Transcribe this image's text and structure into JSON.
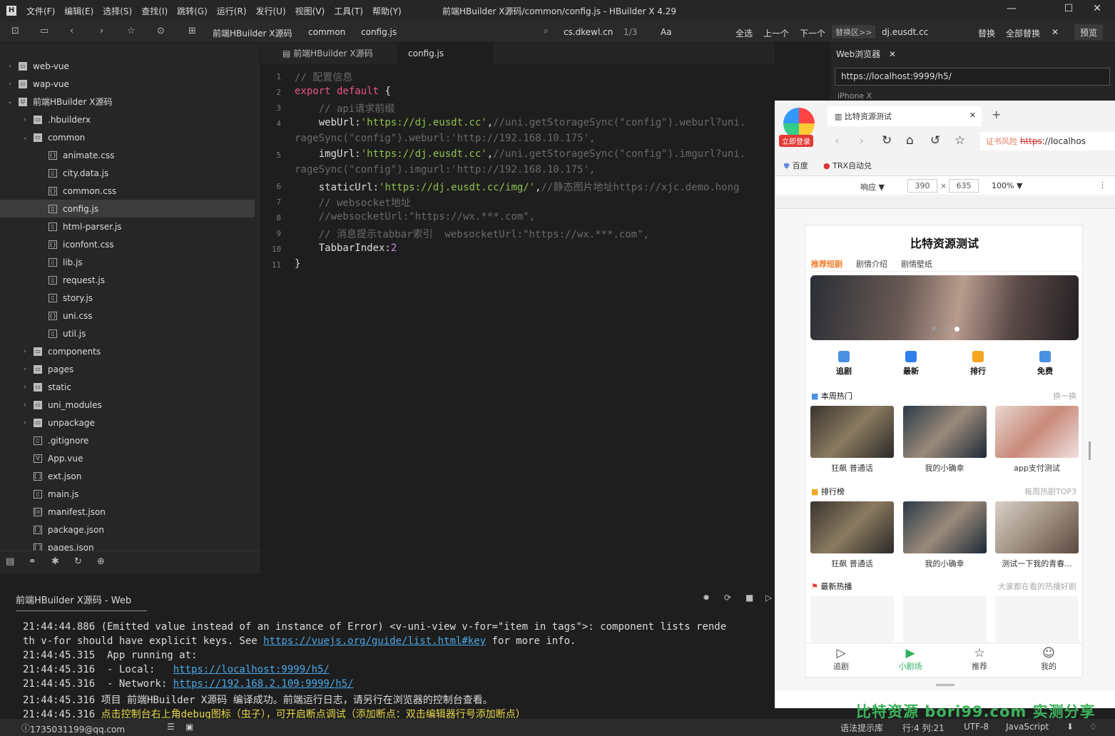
{
  "window": {
    "title": "前端HBuilder X源码/common/config.js - HBuilder X 4.29",
    "menu": [
      "文件(F)",
      "编辑(E)",
      "选择(S)",
      "查找(I)",
      "跳转(G)",
      "运行(R)",
      "发行(U)",
      "视图(V)",
      "工具(T)",
      "帮助(Y)"
    ]
  },
  "toolbar": {
    "crumbs": [
      "前端HBuilder X源码",
      "common",
      "config.js"
    ],
    "find_value": "cs.dkewl.cn",
    "find_count": "1/3",
    "aa": "Aa",
    "select_all": "全选",
    "prev": "上一个",
    "next": "下一个",
    "replace_area": "替换区>>",
    "replace_value": "dj.eusdt.cc",
    "replace": "替换",
    "replace_all": "全部替换",
    "preview": "预览"
  },
  "tree": [
    {
      "label": "web-vue",
      "depth": 0,
      "twisty": "›",
      "icon": "folder"
    },
    {
      "label": "wap-vue",
      "depth": 0,
      "twisty": "›",
      "icon": "folder"
    },
    {
      "label": "前端HBuilder X源码",
      "depth": 0,
      "twisty": "⌄",
      "icon": "project"
    },
    {
      "label": ".hbuilderx",
      "depth": 1,
      "twisty": "›",
      "icon": "folder"
    },
    {
      "label": "common",
      "depth": 1,
      "twisty": "⌄",
      "icon": "folder"
    },
    {
      "label": "animate.css",
      "depth": 2,
      "icon": "{}"
    },
    {
      "label": "city.data.js",
      "depth": 2,
      "icon": "file"
    },
    {
      "label": "common.css",
      "depth": 2,
      "icon": "{}"
    },
    {
      "label": "config.js",
      "depth": 2,
      "icon": "file",
      "selected": true
    },
    {
      "label": "html-parser.js",
      "depth": 2,
      "icon": "file"
    },
    {
      "label": "iconfont.css",
      "depth": 2,
      "icon": "{}"
    },
    {
      "label": "lib.js",
      "depth": 2,
      "icon": "file"
    },
    {
      "label": "request.js",
      "depth": 2,
      "icon": "file"
    },
    {
      "label": "story.js",
      "depth": 2,
      "icon": "file"
    },
    {
      "label": "uni.css",
      "depth": 2,
      "icon": "{}"
    },
    {
      "label": "util.js",
      "depth": 2,
      "icon": "file"
    },
    {
      "label": "components",
      "depth": 1,
      "twisty": "›",
      "icon": "folder"
    },
    {
      "label": "pages",
      "depth": 1,
      "twisty": "›",
      "icon": "folder"
    },
    {
      "label": "static",
      "depth": 1,
      "twisty": "›",
      "icon": "folder"
    },
    {
      "label": "uni_modules",
      "depth": 1,
      "twisty": "›",
      "icon": "folder"
    },
    {
      "label": "unpackage",
      "depth": 1,
      "twisty": "›",
      "icon": "folder"
    },
    {
      "label": ".gitignore",
      "depth": 1,
      "icon": "file"
    },
    {
      "label": "App.vue",
      "depth": 1,
      "icon": "V"
    },
    {
      "label": "ext.json",
      "depth": 1,
      "icon": "[]"
    },
    {
      "label": "main.js",
      "depth": 1,
      "icon": "file"
    },
    {
      "label": "manifest.json",
      "depth": 1,
      "icon": "[o]"
    },
    {
      "label": "package.json",
      "depth": 1,
      "icon": "[]"
    },
    {
      "label": "pages.json",
      "depth": 1,
      "icon": "[]"
    }
  ],
  "tabs": [
    "前端HBuilder X源码",
    "config.js"
  ],
  "code": [
    {
      "n": "1",
      "html": "<span class=cm>// 配置信息</span>"
    },
    {
      "n": "2",
      "html": "<span class=kw>export default</span> {"
    },
    {
      "n": "3",
      "html": "    <span class=cm>// api请求前缀</span>"
    },
    {
      "n": "4",
      "html": "    webUrl:<span class=st>'https://dj.eusdt.cc'</span>,<span class=cm>//uni.getStorageSync(\"config\").weburl?uni.</span>"
    },
    {
      "n": "",
      "html": "<span class=cm>rageSync(\"config\").weburl:'http://192.168.10.175',</span>"
    },
    {
      "n": "5",
      "html": "    imgUrl:<span class=st>'https://dj.eusdt.cc'</span>,<span class=cm>//uni.getStorageSync(\"config\").imgurl?uni.</span>"
    },
    {
      "n": "",
      "html": "<span class=cm>rageSync(\"config\").imgurl:'http://192.168.10.175',</span>"
    },
    {
      "n": "6",
      "html": "    staticUrl:<span class=st>'https://dj.eusdt.cc/img/'</span>,<span class=cm>//静态图片地址https://xjc.demo.hong</span>"
    },
    {
      "n": "7",
      "html": "    <span class=cm>// websocket地址</span>"
    },
    {
      "n": "8",
      "html": "    <span class=cm>//websocketUrl:\"https://wx.***.com\",</span>"
    },
    {
      "n": "9",
      "html": "    <span class=cm>// 消息提示tabbar索引  websocketUrl:\"https://wx.***.com\",</span>"
    },
    {
      "n": "10",
      "html": "    TabbarIndex:<span class=nm>2</span>"
    },
    {
      "n": "11",
      "html": "}"
    }
  ],
  "webview": {
    "tab": "Web浏览器",
    "url": "https://localhost:9999/h5/",
    "device": "iPhone X"
  },
  "browser": {
    "tab_title": "比特资源测试",
    "login": "立即登录",
    "cert_warn": "证书风险",
    "url_strike": "https",
    "url_rest": "://localhos",
    "bookmarks": [
      "百度",
      "TRX自动兑"
    ],
    "responsive": "响应 ▼",
    "w": "390",
    "h": "635",
    "zoom": "100% ▼"
  },
  "app": {
    "title": "比特资源测试",
    "top_tabs": [
      "推荐短剧",
      "剧情介绍",
      "剧情壁纸"
    ],
    "quick": [
      "追剧",
      "最新",
      "排行",
      "免费"
    ],
    "sec1": {
      "title": "本周热门",
      "more": "换一换"
    },
    "hot": [
      "狂飙 普通话",
      "我的小确幸",
      "app支付测试"
    ],
    "sec2": {
      "title": "排行榜",
      "more": "每周热剧TOP3"
    },
    "rank": [
      "狂飙 普通话",
      "我的小确幸",
      "测试一下我的青春..."
    ],
    "sec3": {
      "title": "最新热播",
      "more": "大家都在看的热播好剧"
    },
    "bottom_nav": [
      "追剧",
      "小剧场",
      "推荐",
      "我的"
    ]
  },
  "console": {
    "title": "前端HBuilder X源码 - Web",
    "lines": [
      {
        "t": "21:44:44.886 (Emitted value instead of an instance of Error) <v-uni-view v-for=\"item in tags\">: component lists rende"
      },
      {
        "t": "th v-for should have explicit keys. See ",
        "link": "https://vuejs.org/guide/list.html#key",
        "after": " for more info."
      },
      {
        "t": "21:44:45.315  App running at:"
      },
      {
        "t": "21:44:45.316  - Local:   ",
        "link": "https://localhost:9999/h5/"
      },
      {
        "t": "21:44:45.316  - Network: ",
        "link": "https://192.168.2.109:9999/h5/"
      },
      {
        "t": "21:44:45.316 项目 前端HBuilder X源码 编译成功。前端运行日志，请另行在浏览器的控制台查看。"
      },
      {
        "t": "21:44:45.316 ",
        "yellow": "点击控制台右上角debug图标（虫子），可开启断点调试（添加断点：双击编辑器行号添加断点）"
      }
    ]
  },
  "status": {
    "user": "1735031199@qq.com",
    "hint": "语法提示库",
    "pos": "行:4  列:21",
    "enc": "UTF-8",
    "lang": "JavaScript"
  },
  "watermark": "比特资源 bori99.com 实测分享",
  "colors": {
    "accent": "#f07c2a",
    "green": "#2fb060",
    "bg": "#1e1e1e"
  }
}
